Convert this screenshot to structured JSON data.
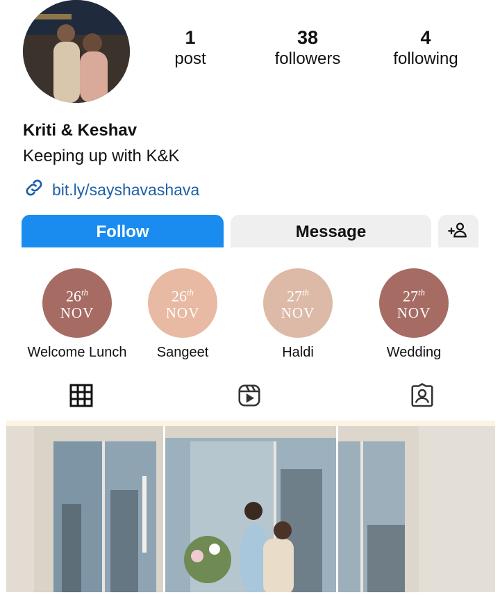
{
  "profile": {
    "name": "Kriti & Keshav",
    "bio": "Keeping up with K&K",
    "link": "bit.ly/sayshavashava",
    "avatar_icon": "couple-photo"
  },
  "stats": {
    "posts": {
      "value": "1",
      "label": "post"
    },
    "followers": {
      "value": "38",
      "label": "followers"
    },
    "following": {
      "value": "4",
      "label": "following"
    }
  },
  "actions": {
    "follow": "Follow",
    "message": "Message",
    "add_user_icon": "add-person-icon"
  },
  "highlights": [
    {
      "day": "26",
      "suffix": "th",
      "month": "NOV",
      "title": "Welcome Lunch",
      "color": "#a66c64"
    },
    {
      "day": "26",
      "suffix": "th",
      "month": "NOV",
      "title": "Sangeet",
      "color": "#e8b9a3"
    },
    {
      "day": "27",
      "suffix": "th",
      "month": "NOV",
      "title": "Haldi",
      "color": "#dcbaa7"
    },
    {
      "day": "27",
      "suffix": "th",
      "month": "NOV",
      "title": "Wedding",
      "color": "#a66c64"
    }
  ],
  "tabs": [
    {
      "name": "grid",
      "icon": "grid-icon"
    },
    {
      "name": "reels",
      "icon": "reels-icon"
    },
    {
      "name": "tagged",
      "icon": "tagged-person-icon"
    }
  ],
  "colors": {
    "accent": "#1a8cf0",
    "link": "#1e5fa8",
    "secondary_button": "#efefef"
  }
}
